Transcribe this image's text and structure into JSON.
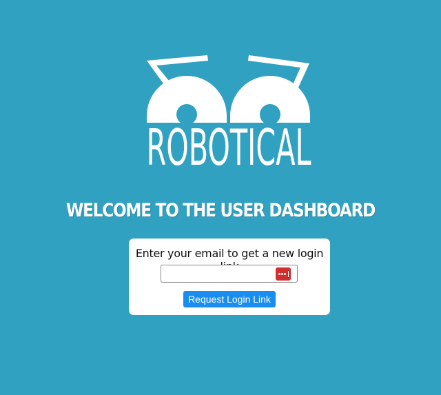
{
  "colors": {
    "background": "#31a1c2",
    "card": "#ffffff",
    "button": "#1a8ef0",
    "password_manager_icon": "#d12f2f"
  },
  "logo": {
    "text": "ROBOTICAL"
  },
  "welcome": {
    "title": "WELCOME TO THE USER DASHBOARD"
  },
  "form": {
    "prompt": "Enter your email to get a new login link",
    "email_value": "",
    "email_placeholder": "",
    "password_manager_icon": "password-manager-icon",
    "button_label": "Request Login Link"
  }
}
